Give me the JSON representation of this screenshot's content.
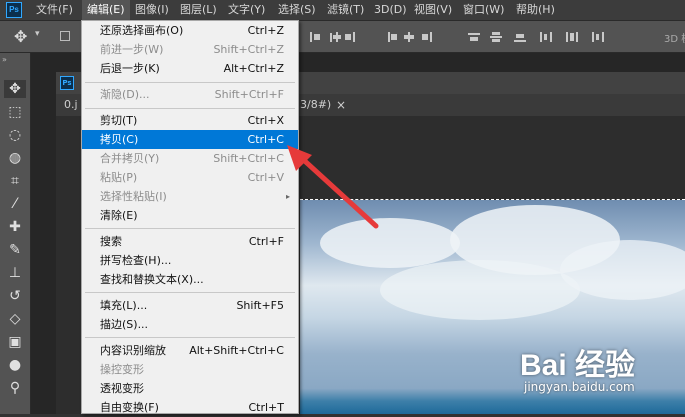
{
  "app": {
    "logo": "Ps"
  },
  "menubar": {
    "items": [
      "文件(F)",
      "编辑(E)",
      "图像(I)",
      "图层(L)",
      "文字(Y)",
      "选择(S)",
      "滤镜(T)",
      "3D(D)",
      "视图(V)",
      "窗口(W)",
      "帮助(H)"
    ],
    "active_index": 1
  },
  "optionsbar": {
    "move_icon": "move-icon",
    "mode_3d_label": "3D 模"
  },
  "document": {
    "tab_left": "0.j",
    "tab_right": "3/8#)",
    "close_glyph": "×"
  },
  "edit_menu": {
    "items": [
      {
        "label": "还原选择画布(O)",
        "shortcut": "Ctrl+Z",
        "disabled": false
      },
      {
        "label": "前进一步(W)",
        "shortcut": "Shift+Ctrl+Z",
        "disabled": true
      },
      {
        "label": "后退一步(K)",
        "shortcut": "Alt+Ctrl+Z",
        "disabled": false
      },
      {
        "label": "渐隐(D)...",
        "shortcut": "Shift+Ctrl+F",
        "disabled": true
      },
      {
        "label": "剪切(T)",
        "shortcut": "Ctrl+X",
        "disabled": false
      },
      {
        "label": "拷贝(C)",
        "shortcut": "Ctrl+C",
        "disabled": false,
        "selected": true
      },
      {
        "label": "合并拷贝(Y)",
        "shortcut": "Shift+Ctrl+C",
        "disabled": true
      },
      {
        "label": "粘贴(P)",
        "shortcut": "Ctrl+V",
        "disabled": true
      },
      {
        "label": "选择性粘贴(I)",
        "shortcut": "",
        "disabled": true,
        "submenu": true
      },
      {
        "label": "清除(E)",
        "shortcut": "",
        "disabled": false
      },
      {
        "label": "搜索",
        "shortcut": "Ctrl+F",
        "disabled": false
      },
      {
        "label": "拼写检查(H)...",
        "shortcut": "",
        "disabled": false
      },
      {
        "label": "查找和替换文本(X)...",
        "shortcut": "",
        "disabled": false
      },
      {
        "label": "填充(L)...",
        "shortcut": "Shift+F5",
        "disabled": false
      },
      {
        "label": "描边(S)...",
        "shortcut": "",
        "disabled": false
      },
      {
        "label": "内容识别缩放",
        "shortcut": "Alt+Shift+Ctrl+C",
        "disabled": false
      },
      {
        "label": "操控变形",
        "shortcut": "",
        "disabled": true
      },
      {
        "label": "透视变形",
        "shortcut": "",
        "disabled": false
      },
      {
        "label": "自由变换(F)",
        "shortcut": "Ctrl+T",
        "disabled": false
      }
    ]
  },
  "watermark": {
    "main": "Bai 经验",
    "sub": "jingyan.baidu.com"
  },
  "colors": {
    "menu_bg": "#f0f0f0",
    "selected": "#0078d7",
    "arrow": "#e63a3a"
  }
}
